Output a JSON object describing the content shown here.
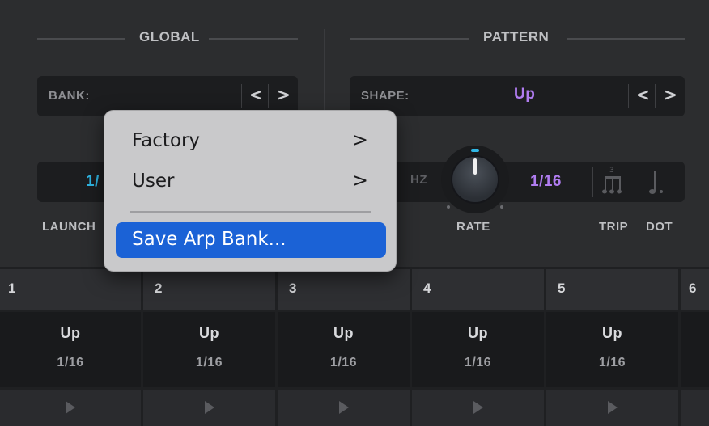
{
  "global": {
    "title": "GLOBAL",
    "bank_label": "BANK:",
    "launch_value": "1/",
    "launch_label": "LAUNCH"
  },
  "pattern": {
    "title": "PATTERN",
    "shape_label": "SHAPE:",
    "shape_value": "Up",
    "hz_label": "HZ",
    "rate_value": "1/16",
    "rate_label": "RATE",
    "trip_label": "TRIP",
    "dot_label": "DOT"
  },
  "steps": [
    {
      "num": "1",
      "shape": "Up",
      "rate": "1/16"
    },
    {
      "num": "2",
      "shape": "Up",
      "rate": "1/16"
    },
    {
      "num": "3",
      "shape": "Up",
      "rate": "1/16"
    },
    {
      "num": "4",
      "shape": "Up",
      "rate": "1/16"
    },
    {
      "num": "5",
      "shape": "Up",
      "rate": "1/16"
    },
    {
      "num": "6",
      "shape": "",
      "rate": ""
    }
  ],
  "menu": {
    "items": [
      {
        "label": "Factory",
        "arrow": ">"
      },
      {
        "label": "User",
        "arrow": ">"
      },
      {
        "label": "Save Arp Bank..."
      }
    ]
  },
  "colors": {
    "accent_cyan": "#2fb6e4",
    "accent_purple": "#b07cf0",
    "menu_highlight": "#1b62d6"
  }
}
